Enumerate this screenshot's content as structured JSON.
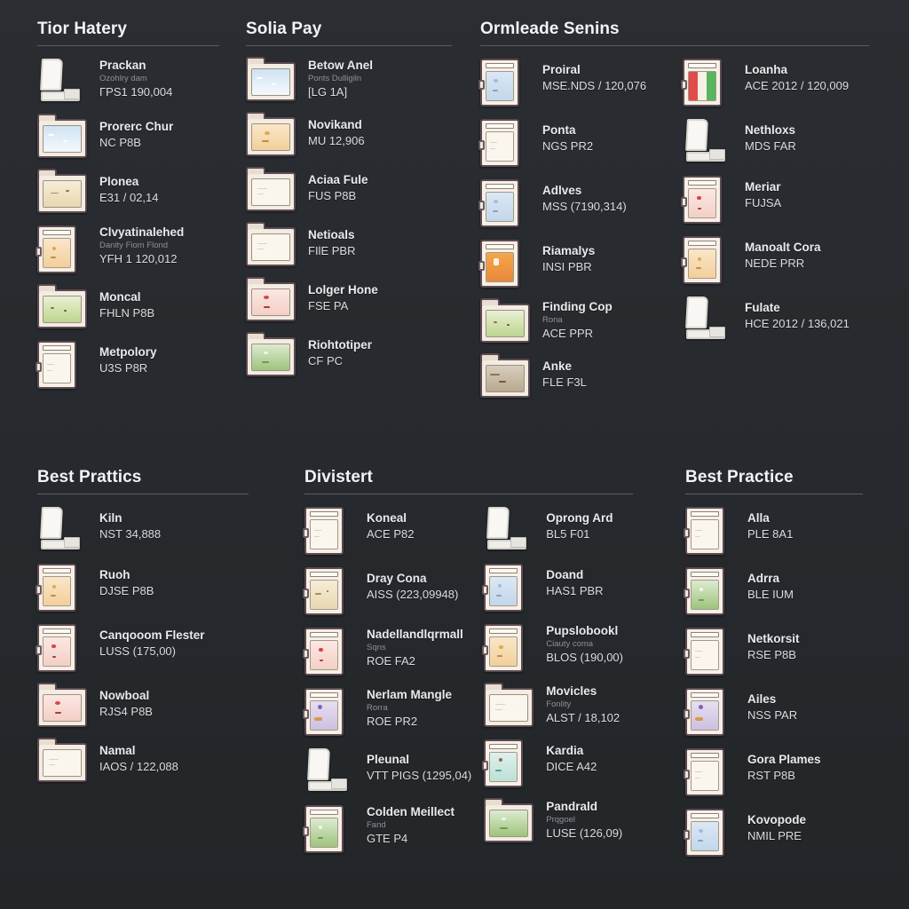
{
  "theme": {
    "background": "#272a2e",
    "title_color": "#f2f3f4",
    "text_color": "#e9eaec",
    "meta_color": "#dcdde0",
    "sub_color": "#8d9196",
    "rule_color": "#5a5e63"
  },
  "sections": [
    {
      "title": "Tior Hatery",
      "columns": [
        {
          "items": [
            {
              "icon": "page-icon",
              "scene": "sc-grey",
              "title": "Prackan",
              "sub": "Ozohlry dam",
              "meta": "ΓPS1 190,004"
            },
            {
              "icon": "folder-icon",
              "scene": "sc-sky",
              "title": "Prorerc Chur",
              "sub": "",
              "meta": "NC P8B"
            },
            {
              "icon": "folder-icon",
              "scene": "sc-sand",
              "title": "Plonea",
              "sub": "",
              "meta": "E31 / 02,14"
            },
            {
              "icon": "card-icon",
              "scene": "sc-warm",
              "title": "Clvyatinalehed",
              "sub": "Danity Fiom Flond",
              "meta": "YFH 1 120,012"
            },
            {
              "icon": "folder-icon",
              "scene": "sc-grass",
              "title": "Moncal",
              "sub": "",
              "meta": "FHLN P8B"
            },
            {
              "icon": "card-icon",
              "scene": "sc-paper",
              "title": "Metpolory",
              "sub": "",
              "meta": "U3S P8R"
            }
          ]
        }
      ]
    },
    {
      "title": "Solia Pay",
      "columns": [
        {
          "items": [
            {
              "icon": "folder-icon",
              "scene": "sc-sky",
              "title": "Betow Anel",
              "sub": "Ponts Dulligiln",
              "meta": "[LG 1A]"
            },
            {
              "icon": "folder-icon",
              "scene": "sc-warm",
              "title": "Novikand",
              "sub": "",
              "meta": "MU 12,906"
            },
            {
              "icon": "folder-icon",
              "scene": "sc-paper",
              "title": "Aciaa Fule",
              "sub": "",
              "meta": "FUS P8B"
            },
            {
              "icon": "folder-icon",
              "scene": "sc-paper",
              "title": "Netioals",
              "sub": "",
              "meta": "FIlE PBR"
            },
            {
              "icon": "folder-icon",
              "scene": "sc-red",
              "title": "Lolger Hone",
              "sub": "",
              "meta": "FSE PA"
            },
            {
              "icon": "folder-icon",
              "scene": "sc-green",
              "title": "Riohtotiper",
              "sub": "",
              "meta": "CF PC"
            }
          ]
        }
      ]
    },
    {
      "title": "Ormleade Senins",
      "columns": [
        {
          "items": [
            {
              "icon": "card-icon",
              "scene": "sc-blue",
              "title": "Proiral",
              "sub": "",
              "meta": "MSE.NDS / 120,076"
            },
            {
              "icon": "card-icon",
              "scene": "sc-paper",
              "title": "Ponta",
              "sub": "",
              "meta": "NGS PR2"
            },
            {
              "icon": "card-icon",
              "scene": "sc-blue",
              "title": "Adlves",
              "sub": "",
              "meta": "MSS (7190,314)"
            },
            {
              "icon": "card-icon",
              "scene": "sc-orange",
              "title": "Riamalys",
              "sub": "",
              "meta": "INSI PBR"
            },
            {
              "icon": "folder-icon",
              "scene": "sc-grass",
              "title": "Finding Cop",
              "sub": "Rona",
              "meta": "ACE PPR"
            },
            {
              "icon": "folder-icon",
              "scene": "sc-dark",
              "title": "Anke",
              "sub": "",
              "meta": "FLE F3L"
            }
          ]
        },
        {
          "items": [
            {
              "icon": "card-icon",
              "scene": "sc-flag",
              "title": "Loanha",
              "sub": "",
              "meta": "ACE 2012 / 120,009"
            },
            {
              "icon": "page-icon",
              "scene": "sc-grey",
              "title": "Nethloxs",
              "sub": "",
              "meta": "MDS FAR"
            },
            {
              "icon": "card-icon",
              "scene": "sc-red",
              "title": "Meriar",
              "sub": "",
              "meta": "FUJSA"
            },
            {
              "icon": "card-icon",
              "scene": "sc-warm",
              "title": "Manoalt Cora",
              "sub": "",
              "meta": "NEDE PRR"
            },
            {
              "icon": "page-icon",
              "scene": "sc-sand",
              "title": "Fulate",
              "sub": "",
              "meta": "HCE 2012 / 136,021"
            }
          ]
        }
      ]
    },
    {
      "title": "Best Prattics",
      "columns": [
        {
          "items": [
            {
              "icon": "page-icon",
              "scene": "sc-grey",
              "title": "Kiln",
              "sub": "",
              "meta": "NST 34,888"
            },
            {
              "icon": "card-icon",
              "scene": "sc-warm",
              "title": "Ruoh",
              "sub": "",
              "meta": "DJSE P8B"
            },
            {
              "icon": "card-icon",
              "scene": "sc-red",
              "title": "Canqooom Flester",
              "sub": "",
              "meta": "LUSS (175,00)"
            },
            {
              "icon": "folder-icon",
              "scene": "sc-red",
              "title": "Nowboal",
              "sub": "",
              "meta": "RJS4 P8B"
            },
            {
              "icon": "folder-icon",
              "scene": "sc-paper",
              "title": "Namal",
              "sub": "",
              "meta": "IAOS / 122,088"
            }
          ]
        }
      ]
    },
    {
      "title": "Divistert",
      "columns": [
        {
          "items": [
            {
              "icon": "card-icon",
              "scene": "sc-paper",
              "title": "Koneal",
              "sub": "",
              "meta": "ACE P82"
            },
            {
              "icon": "card-icon",
              "scene": "sc-sand",
              "title": "Dray Cona",
              "sub": "",
              "meta": "AISS (223,09948)"
            },
            {
              "icon": "card-icon",
              "scene": "sc-red",
              "title": "Nadellandlqrmall",
              "sub": "Sqns",
              "meta": "ROE FA2"
            },
            {
              "icon": "card-icon",
              "scene": "sc-purple",
              "title": "Nerlam Mangle",
              "sub": "Rorra",
              "meta": "ROE PR2"
            },
            {
              "icon": "page-icon",
              "scene": "sc-grey",
              "title": "Pleunal",
              "sub": "",
              "meta": "VTT PIGS (1295,04)"
            },
            {
              "icon": "card-icon",
              "scene": "sc-green",
              "title": "Colden Meillect",
              "sub": "Fand",
              "meta": "GTE P4"
            }
          ]
        },
        {
          "items": [
            {
              "icon": "page-icon",
              "scene": "sc-grey",
              "title": "Oprong Ard",
              "sub": "",
              "meta": "BL5 F01"
            },
            {
              "icon": "card-icon",
              "scene": "sc-blue",
              "title": "Doand",
              "sub": "",
              "meta": "HAS1 PBR"
            },
            {
              "icon": "card-icon",
              "scene": "sc-warm",
              "title": "Pupslobookl",
              "sub": "Ciauty coma",
              "meta": "BLOS (190,00)"
            },
            {
              "icon": "folder-icon",
              "scene": "sc-paper",
              "title": "Movicles",
              "sub": "Fonlity",
              "meta": "ALST / 18,102"
            },
            {
              "icon": "card-icon",
              "scene": "sc-teal",
              "title": "Kardia",
              "sub": "",
              "meta": "DICE A42"
            },
            {
              "icon": "folder-icon",
              "scene": "sc-green",
              "title": "Pandrald",
              "sub": "Prqgoel",
              "meta": "LUSE (126,09)"
            }
          ]
        }
      ]
    },
    {
      "title": "Best Practice",
      "columns": [
        {
          "items": [
            {
              "icon": "card-icon",
              "scene": "sc-paper",
              "title": "Alla",
              "sub": "",
              "meta": "PLE 8A1"
            },
            {
              "icon": "card-icon",
              "scene": "sc-green",
              "title": "Adrra",
              "sub": "",
              "meta": "BLE IUM"
            },
            {
              "icon": "card-icon",
              "scene": "sc-paper",
              "title": "Netkorsit",
              "sub": "",
              "meta": "RSE P8B"
            },
            {
              "icon": "card-icon",
              "scene": "sc-purple",
              "title": "Ailes",
              "sub": "",
              "meta": "NSS PAR"
            },
            {
              "icon": "card-icon",
              "scene": "sc-paper",
              "title": "Gora Plames",
              "sub": "",
              "meta": "RST P8B"
            },
            {
              "icon": "card-icon",
              "scene": "sc-blue",
              "title": "Kovopode",
              "sub": "",
              "meta": "NMIL PRE"
            }
          ]
        }
      ]
    }
  ]
}
